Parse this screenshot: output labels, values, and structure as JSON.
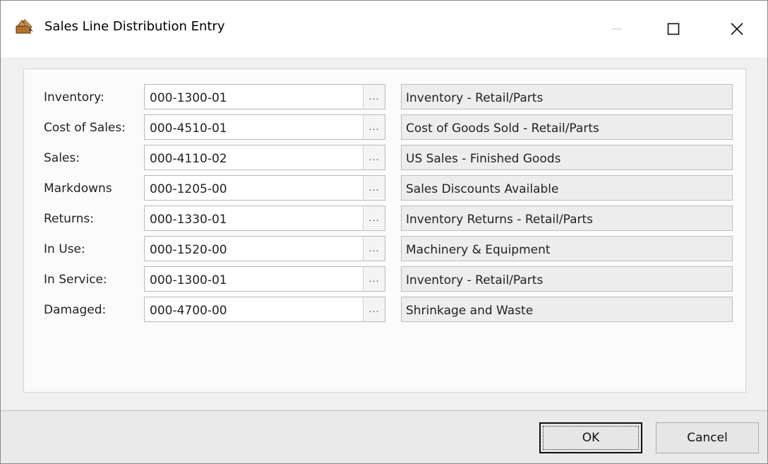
{
  "window": {
    "title": "Sales Line Distribution Entry",
    "app_icon": "paint-brush-icon",
    "controls": [
      "minimize-icon",
      "maximize-icon",
      "close-icon"
    ]
  },
  "rows": [
    {
      "label": "Inventory:",
      "account": "000-1300-01",
      "description": "Inventory - Retail/Parts"
    },
    {
      "label": "Cost of Sales:",
      "account": "000-4510-01",
      "description": "Cost of Goods Sold - Retail/Parts"
    },
    {
      "label": "Sales:",
      "account": "000-4110-02",
      "description": "US Sales - Finished Goods"
    },
    {
      "label": "Markdowns",
      "account": "000-1205-00",
      "description": "Sales Discounts Available"
    },
    {
      "label": "Returns:",
      "account": "000-1330-01",
      "description": "Inventory Returns - Retail/Parts"
    },
    {
      "label": "In Use:",
      "account": "000-1520-00",
      "description": "Machinery & Equipment"
    },
    {
      "label": "In Service:",
      "account": "000-1300-01",
      "description": "Inventory - Retail/Parts"
    },
    {
      "label": "Damaged:",
      "account": "000-4700-00",
      "description": "Shrinkage and Waste"
    }
  ],
  "lookup_label": "...",
  "footer": {
    "ok_label": "OK",
    "cancel_label": "Cancel"
  }
}
